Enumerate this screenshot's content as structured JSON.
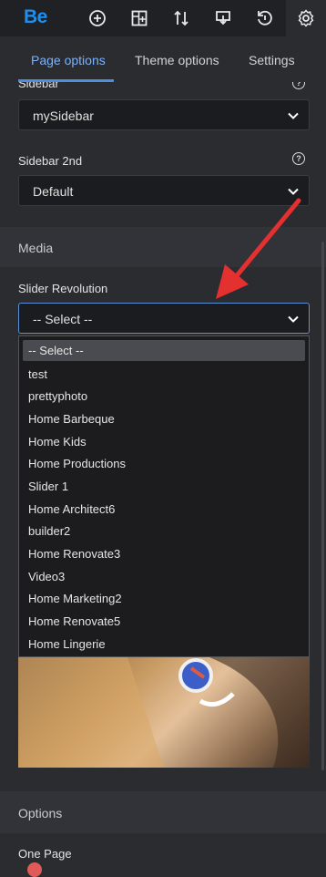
{
  "logo": "Be",
  "topbar_icons": [
    "plus-circle-icon",
    "add-section-icon",
    "sort-icon",
    "download-icon",
    "history-icon",
    "gear-icon"
  ],
  "tabs": [
    {
      "label": "Page options",
      "active": true
    },
    {
      "label": "Theme options",
      "active": false
    },
    {
      "label": "Settings",
      "active": false
    }
  ],
  "sidebar": {
    "label": "Sidebar",
    "value": "mySidebar"
  },
  "sidebar2": {
    "label": "Sidebar 2nd",
    "value": "Default"
  },
  "media_section": {
    "title": "Media"
  },
  "slider": {
    "label": "Slider Revolution",
    "value": "-- Select --",
    "options": [
      "-- Select --",
      "test",
      "prettyphoto",
      "Home Barbeque",
      "Home Kids",
      "Home Productions",
      "Slider 1",
      "Home Architect6",
      "builder2",
      "Home Renovate3",
      "Video3",
      "Home Marketing2",
      "Home Renovate5",
      "Home Lingerie"
    ]
  },
  "options_section": {
    "title": "Options"
  },
  "one_page": {
    "label": "One Page"
  },
  "colors": {
    "accent": "#1e8ef0",
    "tab_active": "#78b2ff",
    "arrow": "#e53030"
  }
}
